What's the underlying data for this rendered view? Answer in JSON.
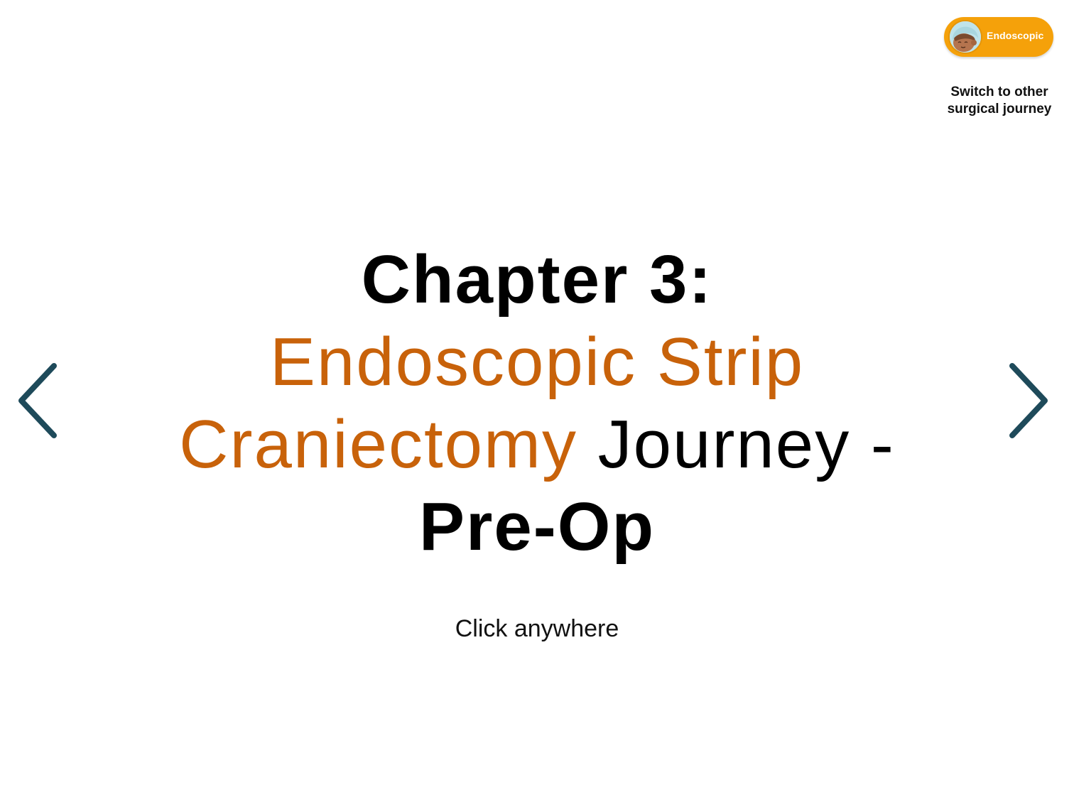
{
  "toggle": {
    "label": "Endoscopic",
    "caption_line1": "Switch to other",
    "caption_line2": "surgical journey",
    "avatar_icon": "baby-face-icon",
    "accent_color": "#f5a10a"
  },
  "nav": {
    "prev_icon": "chevron-left-icon",
    "next_icon": "chevron-right-icon",
    "arrow_color": "#1e4a5a"
  },
  "title": {
    "chapter": "Chapter 3:",
    "highlight_1": "Endoscopic Strip",
    "highlight_2": "Craniectomy",
    "journey": "Journey -",
    "phase": "Pre-Op",
    "highlight_color": "#c8620a"
  },
  "hint": "Click anywhere"
}
